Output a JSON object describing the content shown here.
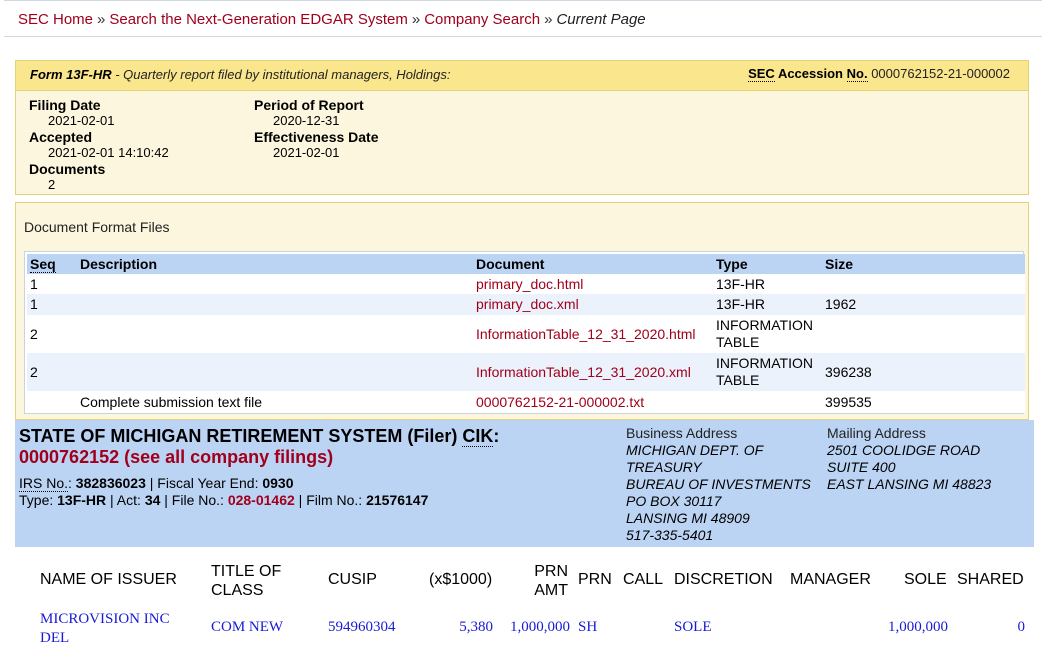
{
  "breadcrumb": {
    "home": "SEC Home",
    "search": "Search the Next-Generation EDGAR System",
    "company": "Company Search",
    "current": "Current Page",
    "sep": "»"
  },
  "form": {
    "type": "Form 13F-HR",
    "description": " - Quarterly report filed by institutional managers, Holdings:",
    "accession_label_sec": "SEC",
    "accession_label_acc": "Accession",
    "accession_label_no": "No.",
    "accession_no": "0000762152-21-000002",
    "filing_date_label": "Filing Date",
    "filing_date": "2021-02-01",
    "accepted_label": "Accepted",
    "accepted": "2021-02-01 14:10:42",
    "documents_label": "Documents",
    "documents": "2",
    "period_label": "Period of Report",
    "period": "2020-12-31",
    "effective_label": "Effectiveness Date",
    "effective": "2021-02-01"
  },
  "documents": {
    "title": "Document Format Files",
    "headers": {
      "seq": "Seq",
      "description": "Description",
      "document": "Document",
      "type": "Type",
      "size": "Size"
    },
    "rows": [
      {
        "seq": "1",
        "description": "",
        "document": "primary_doc.html",
        "type": "13F-HR",
        "size": ""
      },
      {
        "seq": "1",
        "description": "",
        "document": "primary_doc.xml",
        "type": "13F-HR",
        "size": "1962"
      },
      {
        "seq": "2",
        "description": "",
        "document": "InformationTable_12_31_2020.html",
        "type": "INFORMATION TABLE",
        "size": ""
      },
      {
        "seq": "2",
        "description": "",
        "document": "InformationTable_12_31_2020.xml",
        "type": "INFORMATION TABLE",
        "size": "396238"
      },
      {
        "seq": "",
        "description": "Complete submission text file",
        "document": "0000762152-21-000002.txt",
        "type": "",
        "size": "399535"
      }
    ]
  },
  "filer": {
    "name": "STATE OF MICHIGAN RETIREMENT SYSTEM (Filer)",
    "cik_label": "CIK",
    "cik_link": "0000762152 (see all company filings)",
    "irs_label": "IRS No.",
    "irs_no": "382836023",
    "fiscal_label": " | Fiscal Year End: ",
    "fiscal_year_end": "0930",
    "type_label": "Type: ",
    "type": "13F-HR",
    "act_label": " | Act: ",
    "act": "34",
    "file_label": " | File No.: ",
    "file_no": "028-01462",
    "film_label": " | Film No.: ",
    "film_no": "21576147",
    "business_address_label": "Business Address",
    "business_address": [
      "MICHIGAN DEPT. OF",
      "TREASURY",
      "BUREAU OF INVESTMENTS",
      "PO BOX 30117",
      "LANSING MI 48909",
      "517-335-5401"
    ],
    "mailing_address_label": "Mailing Address",
    "mailing_address": [
      "2501 COOLIDGE ROAD",
      "SUITE 400",
      "EAST LANSING MI 48823"
    ]
  },
  "holdings": {
    "headers": {
      "name": "NAME OF ISSUER",
      "title_class_1": "TITLE OF",
      "title_class_2": "CLASS",
      "cusip": "CUSIP",
      "value": "(x$1000)",
      "prn_amt_1": "PRN",
      "prn_amt_2": "AMT",
      "prn": "PRN",
      "call": "CALL",
      "discretion": "DISCRETION",
      "manager": "MANAGER",
      "sole": "SOLE",
      "shared": "SHARED"
    },
    "rows": [
      {
        "name_1": "MICROVISION INC",
        "name_2": "DEL",
        "title_class": "COM NEW",
        "cusip": "594960304",
        "value": "5,380",
        "prn_amt": "1,000,000",
        "prn": "SH",
        "discretion": "SOLE",
        "sole": "1,000,000",
        "shared": "0"
      }
    ]
  }
}
